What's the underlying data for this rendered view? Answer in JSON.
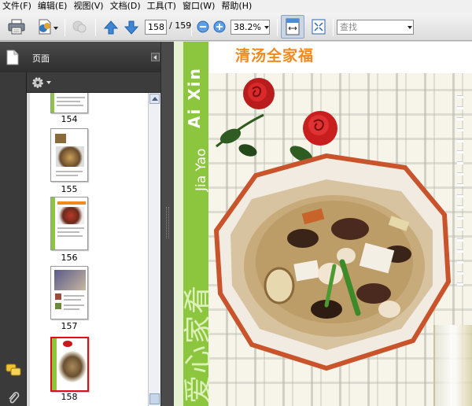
{
  "menu": [
    "文件(F)",
    "编辑(E)",
    "视图(V)",
    "文档(D)",
    "工具(T)",
    "窗口(W)",
    "帮助(H)"
  ],
  "toolbar": {
    "current_page": "158",
    "total_pages": "/ 159",
    "zoom": "38.2%",
    "search_placeholder": "查找"
  },
  "nav": {
    "panel_title": "页面"
  },
  "thumbnails": [
    {
      "label": "154"
    },
    {
      "label": "155"
    },
    {
      "label": "156"
    },
    {
      "label": "157"
    },
    {
      "label": "158"
    }
  ],
  "document": {
    "dish_title": "清汤全家福",
    "brand_pinyin": "Jia Yao",
    "brand_latin": "Ai Xin",
    "brand_chinese": "爱心家肴"
  },
  "colors": {
    "brand_green": "#8cc63e",
    "dish_title_orange": "#f08a1c",
    "current_thumb_border": "#e01010"
  }
}
